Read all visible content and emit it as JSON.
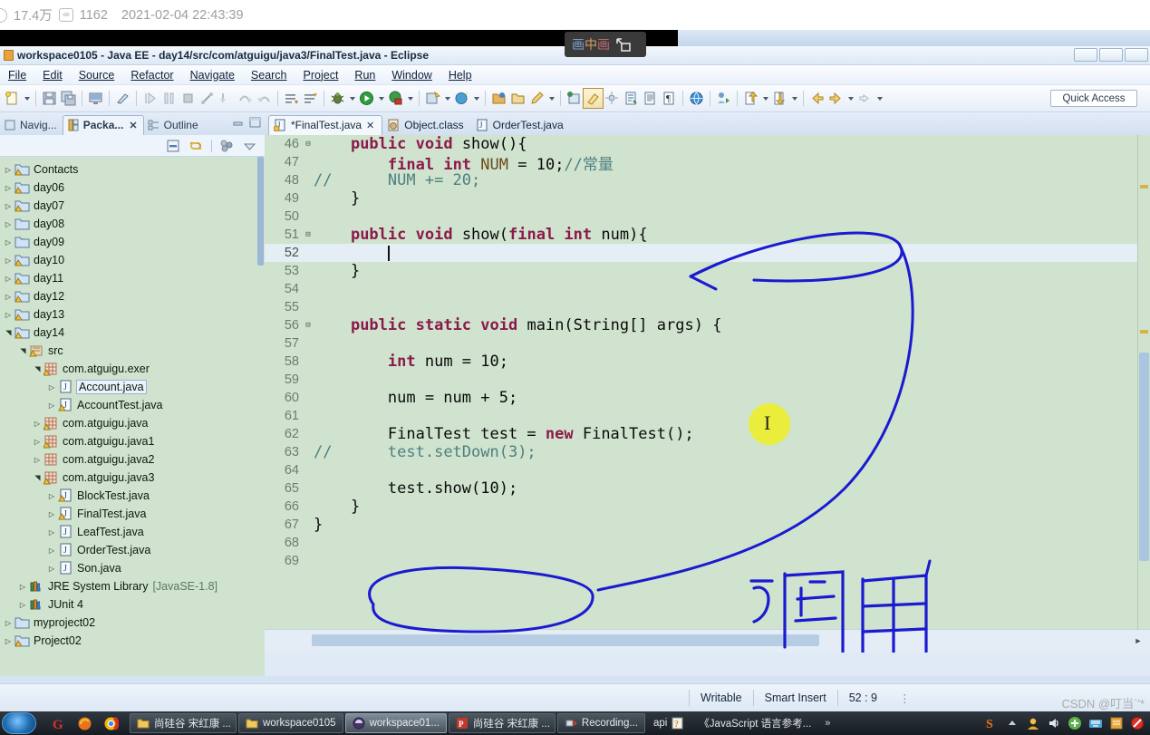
{
  "stats": {
    "views": "17.4万",
    "comments": "1162",
    "date": "2021-02-04 22:43:39"
  },
  "pip": {
    "label_chars": [
      "画",
      "中",
      "画"
    ],
    "icon": "expand-pip-icon"
  },
  "window": {
    "title": "workspace0105 - Java EE - day14/src/com/atguigu/java3/FinalTest.java - Eclipse"
  },
  "menu": [
    {
      "label": "File",
      "mnemonic_index": 0
    },
    {
      "label": "Edit",
      "mnemonic_index": 0
    },
    {
      "label": "Source",
      "mnemonic_index": 0
    },
    {
      "label": "Refactor",
      "mnemonic_index": 4
    },
    {
      "label": "Navigate",
      "mnemonic_index": 0
    },
    {
      "label": "Search",
      "mnemonic_index": 2
    },
    {
      "label": "Project",
      "mnemonic_index": 0
    },
    {
      "label": "Run",
      "mnemonic_index": 0
    },
    {
      "label": "Window",
      "mnemonic_index": 0
    },
    {
      "label": "Help",
      "mnemonic_index": 0
    }
  ],
  "toolbar": {
    "quick_access": "Quick Access",
    "icons": [
      "new-wizard-icon",
      "save-icon",
      "save-all-icon",
      "print-screen-icon",
      "toggle-mark-occurrences-icon",
      "resume-icon",
      "suspend-icon",
      "terminate-icon",
      "disconnect-icon",
      "step-into-icon",
      "step-over-icon",
      "step-return-icon",
      "next-annotation-icon",
      "previous-annotation-icon",
      "debug-icon",
      "run-icon",
      "coverage-icon",
      "external-tools-icon",
      "search-icon",
      "open-type-icon",
      "new-java-project-icon",
      "new-package-icon",
      "new-class-icon",
      "pin-editor-icon",
      "toggle-breadcrumb-icon",
      "open-task-icon",
      "open-document-icon",
      "show-whitespace-icon",
      "open-web-browser-icon",
      "new-xml-icon",
      "previous-edit-icon",
      "next-edit-icon",
      "back-icon",
      "forward-icon",
      "forward-nav-icon"
    ]
  },
  "left_pane": {
    "tabs": [
      {
        "label": "Navig...",
        "icon": "navigator-icon",
        "active": false,
        "closable": false
      },
      {
        "label": "Packa...",
        "icon": "package-explorer-icon",
        "active": true,
        "closable": true
      },
      {
        "label": "Outline",
        "icon": "outline-icon",
        "active": false,
        "closable": false
      }
    ],
    "view_buttons": [
      "minimize-icon",
      "maximize-icon"
    ],
    "view_toolbar": [
      "collapse-all-icon",
      "link-with-editor-icon",
      "view-menu-dots-icon",
      "view-menu-icon"
    ],
    "tree": [
      {
        "label": "Contacts",
        "depth": 0,
        "icon": "java-project-warning-icon",
        "twist": "collapsed"
      },
      {
        "label": "day06",
        "depth": 0,
        "icon": "java-project-warning-icon",
        "twist": "collapsed"
      },
      {
        "label": "day07",
        "depth": 0,
        "icon": "java-project-warning-icon",
        "twist": "collapsed"
      },
      {
        "label": "day08",
        "depth": 0,
        "icon": "java-project-icon",
        "twist": "collapsed"
      },
      {
        "label": "day09",
        "depth": 0,
        "icon": "java-project-icon",
        "twist": "collapsed"
      },
      {
        "label": "day10",
        "depth": 0,
        "icon": "java-project-warning-icon",
        "twist": "collapsed"
      },
      {
        "label": "day11",
        "depth": 0,
        "icon": "java-project-warning-icon",
        "twist": "collapsed"
      },
      {
        "label": "day12",
        "depth": 0,
        "icon": "java-project-warning-icon",
        "twist": "collapsed"
      },
      {
        "label": "day13",
        "depth": 0,
        "icon": "java-project-warning-icon",
        "twist": "collapsed"
      },
      {
        "label": "day14",
        "depth": 0,
        "icon": "java-project-warning-icon",
        "twist": "expanded"
      },
      {
        "label": "src",
        "depth": 1,
        "icon": "source-folder-warning-icon",
        "twist": "expanded"
      },
      {
        "label": "com.atguigu.exer",
        "depth": 2,
        "icon": "package-warning-icon",
        "twist": "expanded"
      },
      {
        "label": "Account.java",
        "depth": 3,
        "icon": "java-file-icon",
        "twist": "collapsed",
        "selected": true
      },
      {
        "label": "AccountTest.java",
        "depth": 3,
        "icon": "java-file-warning-icon",
        "twist": "collapsed"
      },
      {
        "label": "com.atguigu.java",
        "depth": 2,
        "icon": "package-warning-icon",
        "twist": "collapsed"
      },
      {
        "label": "com.atguigu.java1",
        "depth": 2,
        "icon": "package-warning-icon",
        "twist": "collapsed"
      },
      {
        "label": "com.atguigu.java2",
        "depth": 2,
        "icon": "package-icon",
        "twist": "collapsed"
      },
      {
        "label": "com.atguigu.java3",
        "depth": 2,
        "icon": "package-warning-icon",
        "twist": "expanded"
      },
      {
        "label": "BlockTest.java",
        "depth": 3,
        "icon": "java-file-warning-icon",
        "twist": "collapsed"
      },
      {
        "label": "FinalTest.java",
        "depth": 3,
        "icon": "java-file-warning-icon",
        "twist": "collapsed"
      },
      {
        "label": "LeafTest.java",
        "depth": 3,
        "icon": "java-file-icon",
        "twist": "collapsed"
      },
      {
        "label": "OrderTest.java",
        "depth": 3,
        "icon": "java-file-icon",
        "twist": "collapsed"
      },
      {
        "label": "Son.java",
        "depth": 3,
        "icon": "java-file-icon",
        "twist": "collapsed"
      },
      {
        "label": "JRE System Library",
        "sublabel": "[JavaSE-1.8]",
        "depth": 1,
        "icon": "library-icon",
        "twist": "collapsed"
      },
      {
        "label": "JUnit 4",
        "depth": 1,
        "icon": "library-icon",
        "twist": "collapsed"
      },
      {
        "label": "myproject02",
        "depth": 0,
        "icon": "java-project-icon",
        "twist": "collapsed"
      },
      {
        "label": "Project02",
        "depth": 0,
        "icon": "java-project-warning-icon",
        "twist": "collapsed"
      }
    ]
  },
  "editor": {
    "tabs": [
      {
        "label": "*FinalTest.java",
        "icon": "java-file-warning-icon",
        "active": true,
        "closable": true
      },
      {
        "label": "Object.class",
        "icon": "class-file-icon",
        "active": false,
        "closable": false
      },
      {
        "label": "OrderTest.java",
        "icon": "java-file-icon",
        "active": false,
        "closable": false
      }
    ],
    "lines": [
      {
        "num": 46,
        "fold": "minus",
        "indent": 4,
        "text": "public void show(){",
        "tokens": [
          [
            "k",
            "public"
          ],
          [
            "pl",
            " "
          ],
          [
            "k",
            "void"
          ],
          [
            "pl",
            " show(){"
          ]
        ]
      },
      {
        "num": 47,
        "fold": "",
        "indent": 8,
        "marker": "warning",
        "text": "final int NUM = 10;//常量",
        "tokens": [
          [
            "k",
            "final"
          ],
          [
            "pl",
            " "
          ],
          [
            "k",
            "int"
          ],
          [
            "pl",
            " "
          ],
          [
            "fld",
            "NUM"
          ],
          [
            "pl",
            " = 10;"
          ],
          [
            "cm",
            "//常量"
          ]
        ]
      },
      {
        "num": 48,
        "fold": "",
        "indent": 0,
        "prefix": "//",
        "text": "//      NUM += 20;",
        "tokens": [
          [
            "cm",
            "//"
          ],
          [
            "pl",
            "      "
          ],
          [
            "cm",
            "NUM += 20;"
          ]
        ]
      },
      {
        "num": 49,
        "fold": "",
        "indent": 4,
        "text": "}",
        "tokens": [
          [
            "pl",
            "}"
          ]
        ]
      },
      {
        "num": 50,
        "fold": "",
        "indent": 0,
        "text": "",
        "tokens": []
      },
      {
        "num": 51,
        "fold": "minus",
        "indent": 4,
        "text": "public void show(final int num){",
        "tokens": [
          [
            "k",
            "public"
          ],
          [
            "pl",
            " "
          ],
          [
            "k",
            "void"
          ],
          [
            "pl",
            " show("
          ],
          [
            "k",
            "final"
          ],
          [
            "pl",
            " "
          ],
          [
            "k",
            "int"
          ],
          [
            "pl",
            " num){"
          ]
        ]
      },
      {
        "num": 52,
        "fold": "",
        "indent": 8,
        "text": "",
        "current": true,
        "caret": true,
        "tokens": []
      },
      {
        "num": 53,
        "fold": "",
        "indent": 4,
        "text": "}",
        "tokens": [
          [
            "pl",
            "}"
          ]
        ]
      },
      {
        "num": 54,
        "fold": "",
        "indent": 0,
        "text": "",
        "tokens": []
      },
      {
        "num": 55,
        "fold": "",
        "indent": 0,
        "text": "",
        "tokens": []
      },
      {
        "num": 56,
        "fold": "minus",
        "indent": 4,
        "text": "public static void main(String[] args) {",
        "tokens": [
          [
            "k",
            "public"
          ],
          [
            "pl",
            " "
          ],
          [
            "k",
            "static"
          ],
          [
            "pl",
            " "
          ],
          [
            "k",
            "void"
          ],
          [
            "pl",
            " main(String[] args) {"
          ]
        ]
      },
      {
        "num": 57,
        "fold": "",
        "indent": 0,
        "text": "",
        "tokens": []
      },
      {
        "num": 58,
        "fold": "",
        "indent": 8,
        "text": "int num = 10;",
        "tokens": [
          [
            "k",
            "int"
          ],
          [
            "pl",
            " num = 10;"
          ]
        ]
      },
      {
        "num": 59,
        "fold": "",
        "indent": 0,
        "text": "",
        "tokens": []
      },
      {
        "num": 60,
        "fold": "",
        "indent": 8,
        "text": "num = num + 5;",
        "tokens": [
          [
            "pl",
            "num = num + 5;"
          ]
        ]
      },
      {
        "num": 61,
        "fold": "",
        "indent": 0,
        "text": "",
        "tokens": []
      },
      {
        "num": 62,
        "fold": "",
        "indent": 8,
        "marker": "warning",
        "text": "FinalTest test = new FinalTest();",
        "tokens": [
          [
            "pl",
            "FinalTest test = "
          ],
          [
            "k",
            "new"
          ],
          [
            "pl",
            " FinalTest();"
          ]
        ]
      },
      {
        "num": 63,
        "fold": "",
        "indent": 0,
        "prefix": "//",
        "text": "//      test.setDown(3);",
        "tokens": [
          [
            "cm",
            "//"
          ],
          [
            "pl",
            "      "
          ],
          [
            "cm",
            "test.setDown(3);"
          ]
        ]
      },
      {
        "num": 64,
        "fold": "",
        "indent": 0,
        "text": "",
        "tokens": []
      },
      {
        "num": 65,
        "fold": "",
        "indent": 8,
        "text": "test.show(10);",
        "tokens": [
          [
            "pl",
            "test.show(10);"
          ]
        ]
      },
      {
        "num": 66,
        "fold": "",
        "indent": 4,
        "text": "}",
        "tokens": [
          [
            "pl",
            "}"
          ]
        ]
      },
      {
        "num": 67,
        "fold": "",
        "indent": 0,
        "text": "}",
        "tokens": [
          [
            "pl",
            "}"
          ]
        ]
      },
      {
        "num": 68,
        "fold": "",
        "indent": 0,
        "text": "",
        "tokens": []
      },
      {
        "num": 69,
        "fold": "",
        "indent": 0,
        "text": "",
        "tokens": []
      }
    ],
    "annotations": [
      {
        "type": "arrow-to-parameter",
        "note": "blue arrow pointing at show(final int num) parameter"
      },
      {
        "type": "ellipse-around-call",
        "note": "blue ellipse around test.show(10);"
      },
      {
        "type": "handwritten-text",
        "text": "调用",
        "color": "#1a1ad0"
      }
    ]
  },
  "status": {
    "writable": "Writable",
    "insert_mode": "Smart Insert",
    "position": "52 : 9"
  },
  "taskbar": {
    "quick_launch": [
      "google-icon",
      "firefox-icon",
      "chrome-icon"
    ],
    "items": [
      {
        "label": "尚硅谷 宋红康 ...",
        "icon": "folder-icon",
        "active": false
      },
      {
        "label": "workspace0105",
        "icon": "folder-icon",
        "active": false
      },
      {
        "label": "workspace01...",
        "icon": "eclipse-icon",
        "active": true
      },
      {
        "label": "尚硅谷 宋红康 ...",
        "icon": "powerpoint-icon",
        "active": false
      },
      {
        "label": "Recording...",
        "icon": "recorder-icon",
        "active": false
      },
      {
        "label": "api",
        "icon": "chm-help-icon",
        "active": false
      },
      {
        "label": "《JavaScript 语言参考...",
        "icon": "chm-help-icon",
        "active": false
      }
    ],
    "tray": [
      "sogou-s-icon",
      "up-chevron-icon",
      "user-icon",
      "volume-icon",
      "add-icon",
      "keyboard-icon",
      "note-icon",
      "block-icon"
    ],
    "overflow": "»"
  },
  "watermark": "CSDN @叮当`'*",
  "colors": {
    "editor_background": "#cfe3cf",
    "ink_blue": "#1a1ad0",
    "cursor_glow": "#eeee22",
    "keyword": "#8b1a4a",
    "comment": "#4f7f7f",
    "field": "#6a4a1a",
    "current_line": "#e4eef4"
  }
}
